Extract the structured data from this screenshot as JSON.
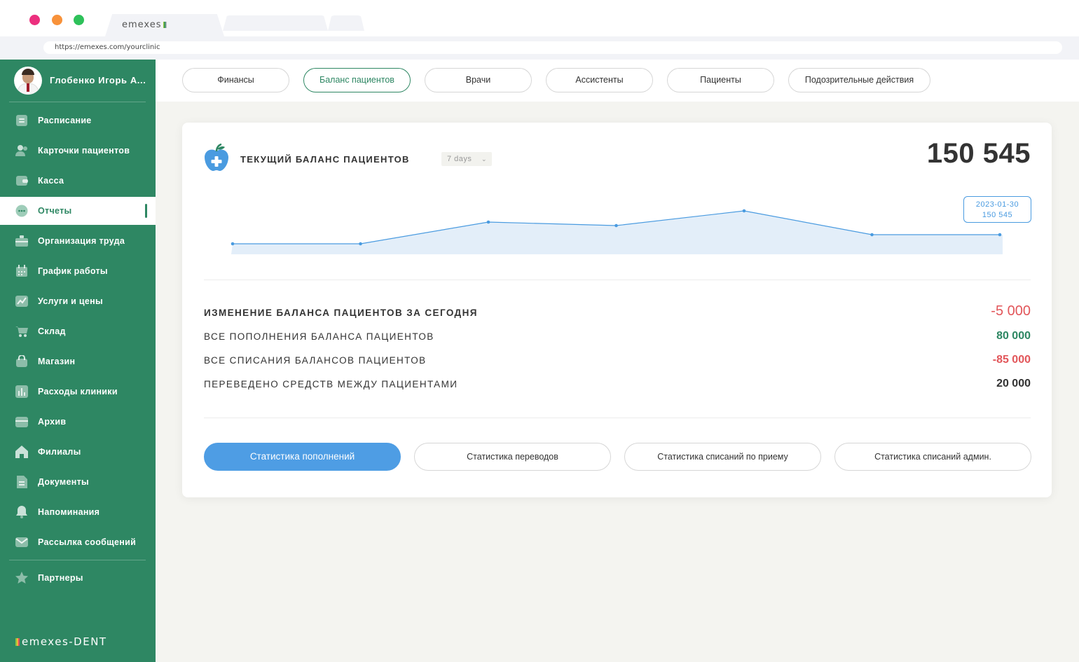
{
  "browser": {
    "tab_label": "emexes",
    "url": "https://emexes.com/yourclinic"
  },
  "sidebar": {
    "user_name": "Глобенко Игорь А...",
    "items": [
      {
        "label": "Расписание",
        "icon": "schedule-icon"
      },
      {
        "label": "Карточки пациентов",
        "icon": "patients-icon"
      },
      {
        "label": "Касса",
        "icon": "wallet-icon"
      },
      {
        "label": "Отчеты",
        "icon": "chat-icon",
        "active": true
      },
      {
        "label": "Организация труда",
        "icon": "briefcase-icon"
      },
      {
        "label": "График работы",
        "icon": "calendar-icon"
      },
      {
        "label": "Услуги и цены",
        "icon": "trend-icon"
      },
      {
        "label": "Склад",
        "icon": "cart-icon"
      },
      {
        "label": "Магазин",
        "icon": "bag-icon"
      },
      {
        "label": "Расходы клиники",
        "icon": "bar-chart-icon"
      },
      {
        "label": "Архив",
        "icon": "archive-icon"
      },
      {
        "label": "Филиалы",
        "icon": "home-icon"
      },
      {
        "label": "Документы",
        "icon": "document-icon"
      },
      {
        "label": "Напоминания",
        "icon": "bell-icon"
      },
      {
        "label": "Рассылка сообщений",
        "icon": "mail-icon"
      },
      {
        "label": "Партнеры",
        "icon": "star-icon"
      }
    ],
    "brand": "emexes-DENT"
  },
  "tabs": [
    {
      "label": "Финансы"
    },
    {
      "label": "Баланс пациентов",
      "active": true
    },
    {
      "label": "Врачи"
    },
    {
      "label": "Ассистенты"
    },
    {
      "label": "Пациенты"
    },
    {
      "label": "Подозрительные действия"
    }
  ],
  "card": {
    "title": "ТЕКУЩИЙ БАЛАНС ПАЦИЕНТОВ",
    "range": "7 days",
    "total": "150 545",
    "tooltip": {
      "date": "2023-01-30",
      "value": "150 545"
    },
    "stats": [
      {
        "label": "ИЗМЕНЕНИЕ БАЛАНСА ПАЦИЕНТОВ ЗА СЕГОДНЯ",
        "value": "-5 000",
        "tone": "neg"
      },
      {
        "label": "ВСЕ ПОПОЛНЕНИЯ БАЛАНСА ПАЦИЕНТОВ",
        "value": "80 000",
        "tone": "pos"
      },
      {
        "label": "ВСЕ СПИСАНИЯ БАЛАНСОВ ПАЦИЕНТОВ",
        "value": "-85 000",
        "tone": "neg"
      },
      {
        "label": "ПЕРЕВЕДЕНО СРЕДСТВ МЕЖДУ ПАЦИЕНТАМИ",
        "value": "20 000",
        "tone": "neu"
      }
    ],
    "buttons": [
      {
        "label": "Статистика пополнений",
        "primary": true
      },
      {
        "label": "Статистика переводов"
      },
      {
        "label": "Статистика списаний по приему"
      },
      {
        "label": "Статистика списаний админ."
      }
    ]
  },
  "chart_data": {
    "type": "area",
    "title": "",
    "points": [
      0.1,
      0.1,
      0.41,
      0.36,
      0.57,
      0.23,
      0.23
    ],
    "color": "#4a9be0",
    "fill": "#e3eef9"
  }
}
